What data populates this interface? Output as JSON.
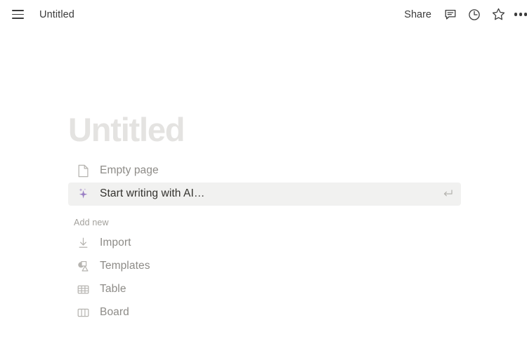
{
  "topbar": {
    "menu_icon": "hamburger-menu-icon",
    "document_title": "Untitled",
    "share_label": "Share",
    "comment_icon": "comment-icon",
    "history_icon": "clock-history-icon",
    "favorite_icon": "star-icon",
    "more_icon": "more-horizontal-icon"
  },
  "page": {
    "title_placeholder": "Untitled"
  },
  "suggestions": [
    {
      "label": "Empty page",
      "icon": "page-document-icon",
      "selected": false,
      "shortcut_icon": ""
    },
    {
      "label": "Start writing with AI…",
      "icon": "ai-sparkle-icon",
      "selected": true,
      "shortcut_icon": "enter-return-icon"
    }
  ],
  "add_new": {
    "section_label": "Add new",
    "items": [
      {
        "label": "Import",
        "icon": "download-import-icon"
      },
      {
        "label": "Templates",
        "icon": "shapes-templates-icon"
      },
      {
        "label": "Table",
        "icon": "table-grid-icon"
      },
      {
        "label": "Board",
        "icon": "board-columns-icon"
      }
    ]
  },
  "colors": {
    "accent_ai": "#9a7fc4",
    "selected_row_bg": "#f1f1f0",
    "title_placeholder": "#e4e3e1",
    "muted_text": "#8d8b87",
    "primary_text": "#33322e"
  }
}
